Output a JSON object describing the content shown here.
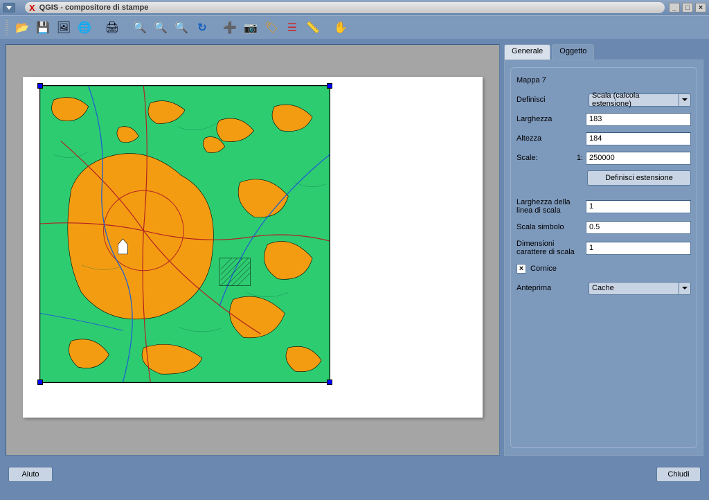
{
  "window": {
    "title": "QGIS - compositore di stampe",
    "min_label": "_",
    "max_label": "□",
    "close_label": "×"
  },
  "toolbar_icons": {
    "open": "📂",
    "save": "💾",
    "export_image": "🖼",
    "export_svg": "🌐",
    "print": "🖨",
    "zoom_full": "🔍",
    "zoom_in": "🔍",
    "zoom_out": "🔍",
    "refresh": "↻",
    "add_map": "➕",
    "add_image": "📷",
    "add_label": "🏷",
    "add_legend": "☰",
    "add_scalebar": "📏",
    "move": "✋"
  },
  "tabs": {
    "general": "Generale",
    "object": "Oggetto"
  },
  "panel": {
    "title": "Mappa 7",
    "define_label": "Definisci",
    "define_value": "Scala (calcola estensione)",
    "width_label": "Larghezza",
    "width_value": "183",
    "height_label": "Altezza",
    "height_value": "184",
    "scale_label": "Scale:",
    "scale_prefix": "1:",
    "scale_value": "250000",
    "define_extent_btn": "Definisci estensione",
    "line_width_label": "Larghezza della linea di scala",
    "line_width_value": "1",
    "symbol_scale_label": "Scala simbolo",
    "symbol_scale_value": "0.5",
    "font_size_label": "Dimensioni carattere di scala",
    "font_size_value": "1",
    "frame_checkbox_label": "Cornice",
    "frame_checked": "×",
    "preview_label": "Anteprima",
    "preview_value": "Cache"
  },
  "buttons": {
    "help": "Aiuto",
    "close": "Chiudi"
  }
}
